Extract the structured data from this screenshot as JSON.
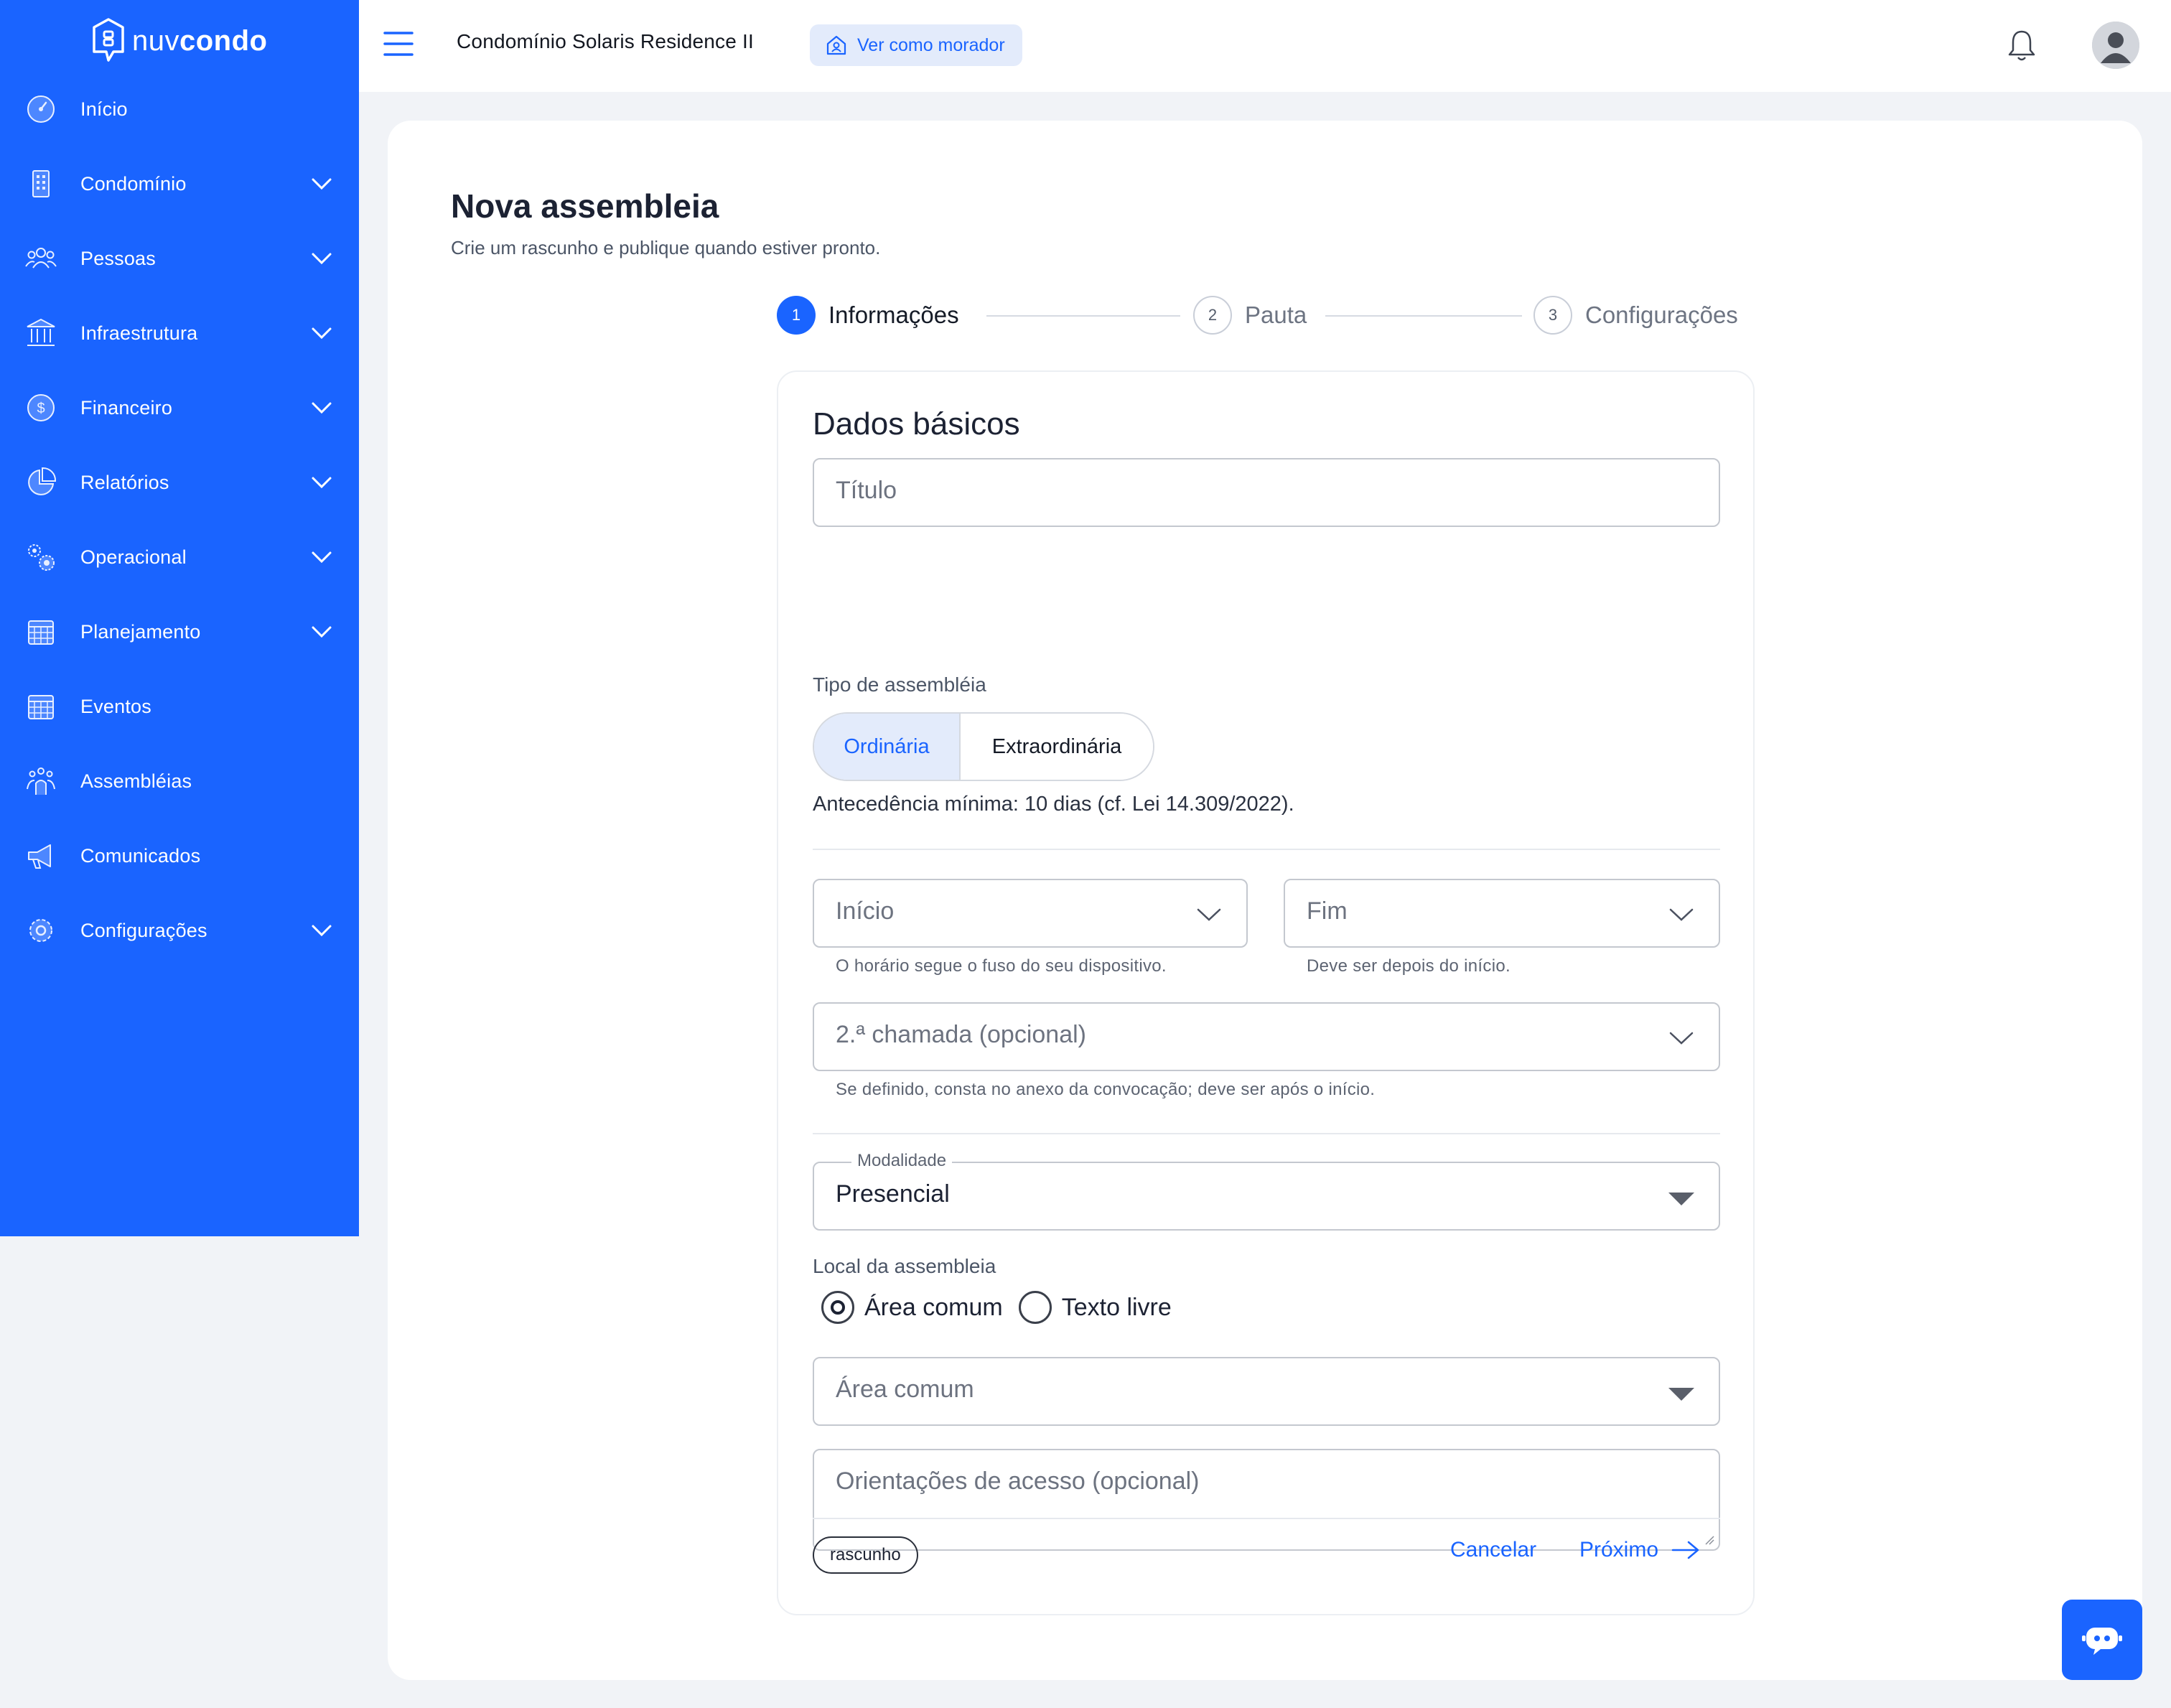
{
  "brand": {
    "name_light": "nuv",
    "name_bold": "condo"
  },
  "sidebar": {
    "items": [
      {
        "label": "Início",
        "icon": "dashboard-gauge-icon",
        "expandable": false
      },
      {
        "label": "Condomínio",
        "icon": "building-icon",
        "expandable": true
      },
      {
        "label": "Pessoas",
        "icon": "people-icon",
        "expandable": true
      },
      {
        "label": "Infraestrutura",
        "icon": "bank-columns-icon",
        "expandable": true
      },
      {
        "label": "Financeiro",
        "icon": "dollar-coin-icon",
        "expandable": true
      },
      {
        "label": "Relatórios",
        "icon": "pie-chart-icon",
        "expandable": true
      },
      {
        "label": "Operacional",
        "icon": "gears-icon",
        "expandable": true
      },
      {
        "label": "Planejamento",
        "icon": "calendar-icon",
        "expandable": true
      },
      {
        "label": "Eventos",
        "icon": "calendar-grid-icon",
        "expandable": false
      },
      {
        "label": "Assembléias",
        "icon": "assembly-group-icon",
        "expandable": false
      },
      {
        "label": "Comunicados",
        "icon": "megaphone-icon",
        "expandable": false
      },
      {
        "label": "Configurações",
        "icon": "settings-gear-icon",
        "expandable": true
      }
    ]
  },
  "topbar": {
    "condo_name": "Condomínio Solaris Residence II",
    "view_as_label": "Ver como morador"
  },
  "page": {
    "title": "Nova assembleia",
    "subtitle": "Crie um rascunho e publique quando estiver pronto."
  },
  "stepper": {
    "steps": [
      {
        "number": "1",
        "label": "Informações",
        "state": "active"
      },
      {
        "number": "2",
        "label": "Pauta",
        "state": "inactive"
      },
      {
        "number": "3",
        "label": "Configurações",
        "state": "inactive"
      }
    ]
  },
  "form": {
    "section_title": "Dados básicos",
    "title_placeholder": "Título",
    "type_label": "Tipo de assembléia",
    "type_options": [
      "Ordinária",
      "Extraordinária"
    ],
    "type_selected": "Ordinária",
    "notice_text": "Antecedência mínima: 10 dias (cf. Lei 14.309/2022).",
    "start_placeholder": "Início",
    "start_helper": "O horário segue o fuso do seu dispositivo.",
    "end_placeholder": "Fim",
    "end_helper": "Deve ser depois do início.",
    "second_call_placeholder": "2.ª chamada (opcional)",
    "second_call_helper": "Se definido, consta no anexo da convocação; deve ser após o início.",
    "modality_label": "Modalidade",
    "modality_value": "Presencial",
    "location_label": "Local da assembleia",
    "location_options": [
      "Área comum",
      "Texto livre"
    ],
    "location_selected": "Área comum",
    "common_area_placeholder": "Área comum",
    "access_placeholder": "Orientações de acesso (opcional)"
  },
  "footer": {
    "status_badge": "rascunho",
    "cancel_label": "Cancelar",
    "next_label": "Próximo"
  },
  "colors": {
    "primary": "#1a64ff",
    "primary_soft": "#e3ebfb",
    "background": "#f1f3f7"
  }
}
